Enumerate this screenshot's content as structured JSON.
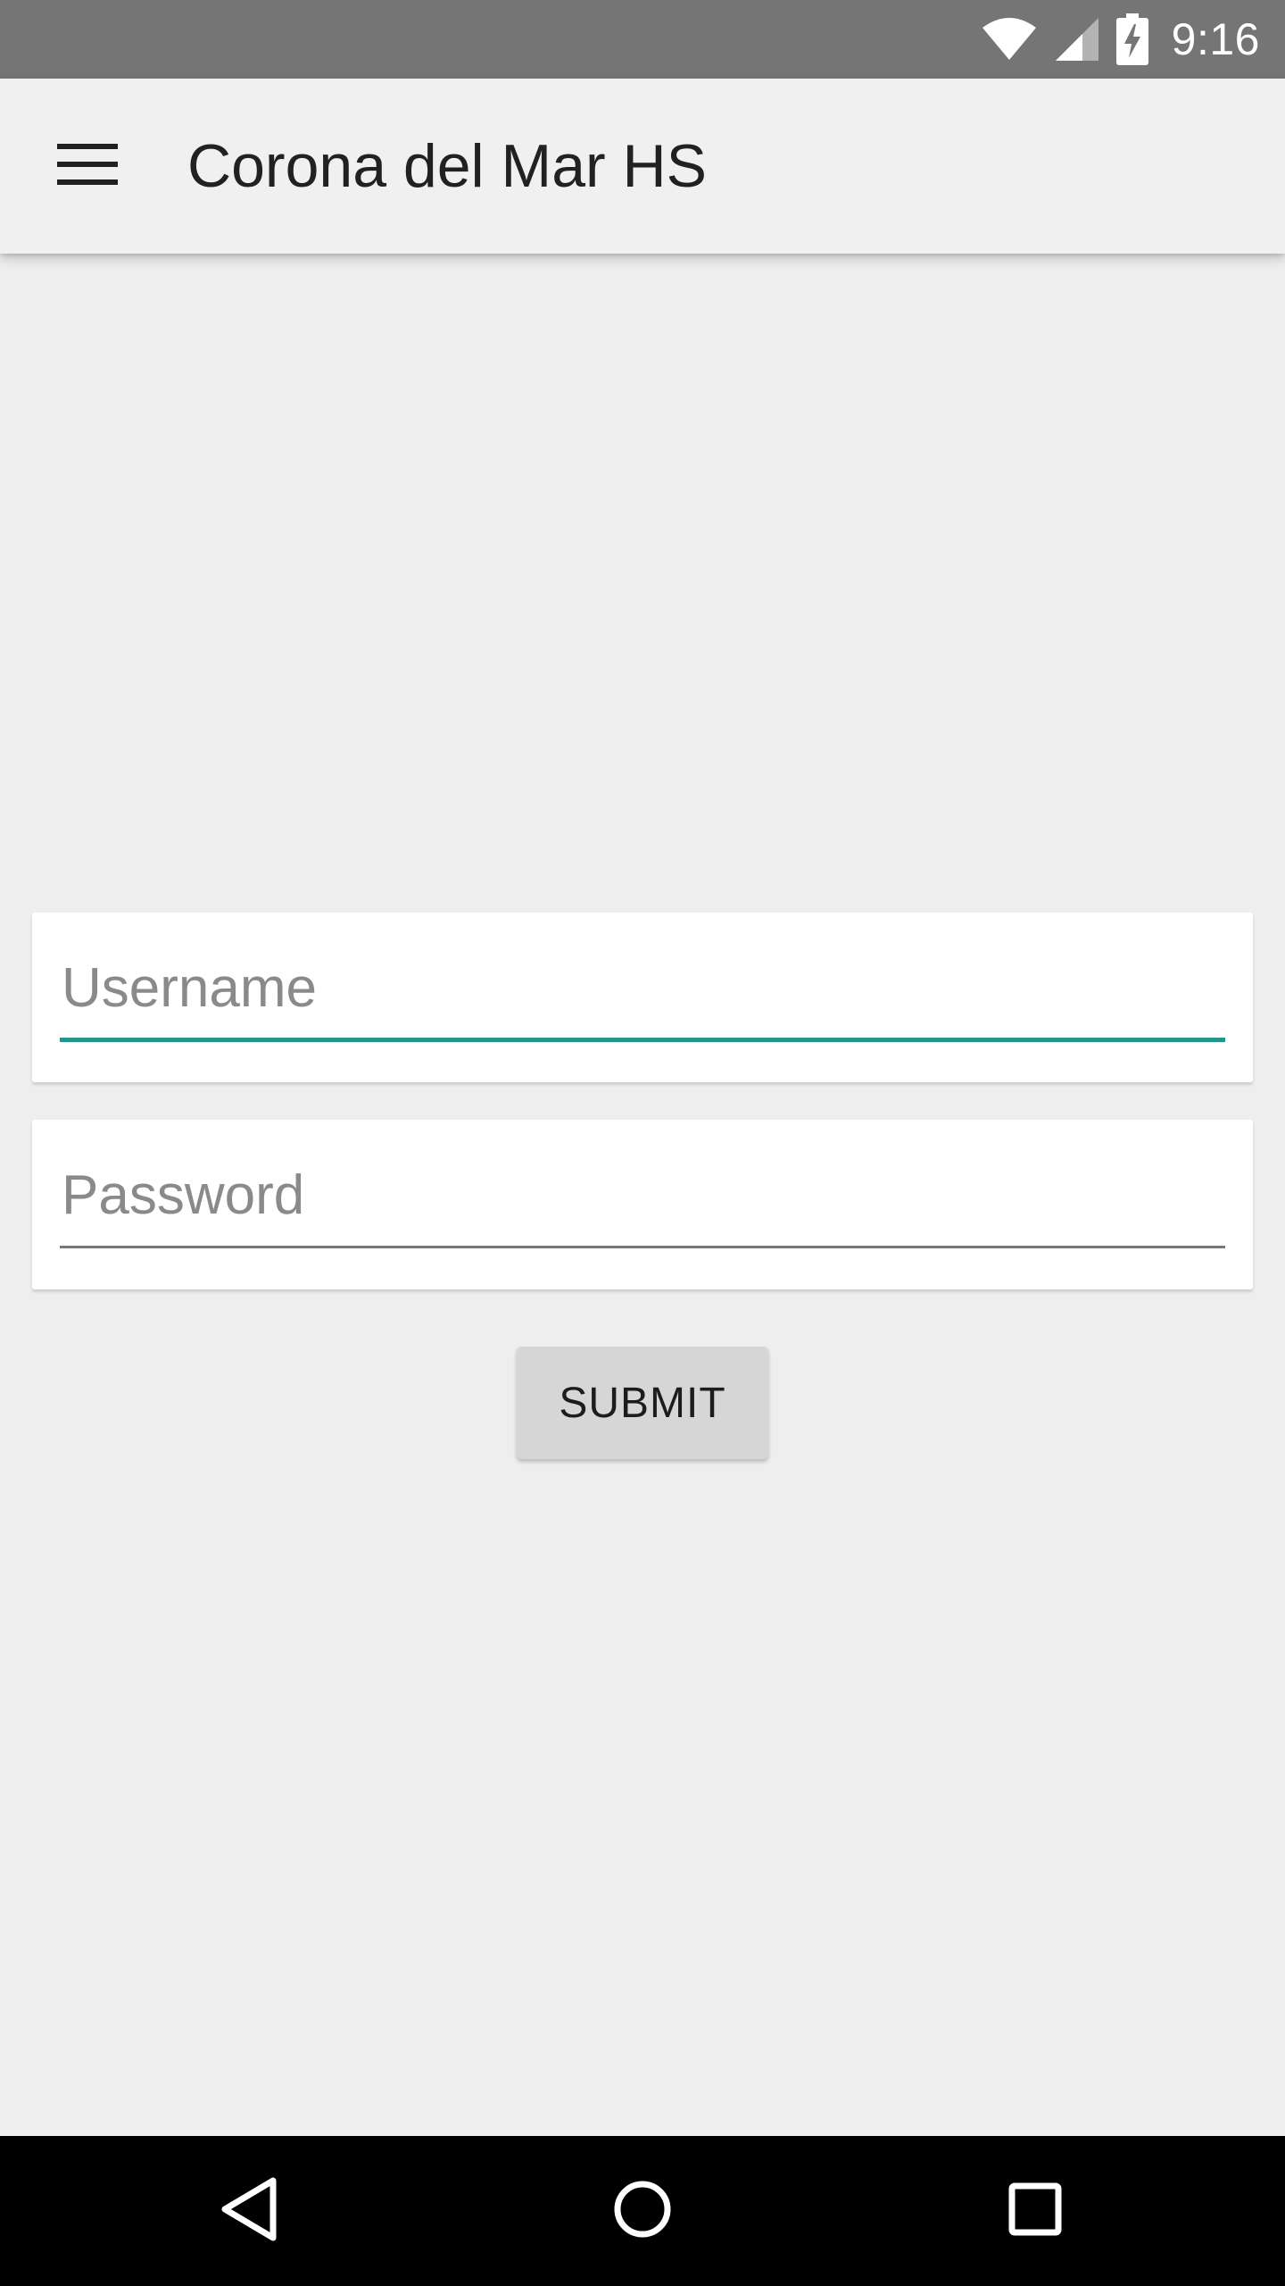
{
  "status_bar": {
    "time": "9:16",
    "icons": [
      "wifi-icon",
      "cell-signal-icon",
      "battery-charging-icon"
    ]
  },
  "app_bar": {
    "title": "Corona del Mar HS",
    "menu_icon": "hamburger-menu-icon"
  },
  "login_form": {
    "username": {
      "placeholder": "Username",
      "value": "",
      "focused": true
    },
    "password": {
      "placeholder": "Password",
      "value": "",
      "focused": false
    },
    "submit_label": "SUBMIT"
  },
  "nav_bar": {
    "buttons": [
      "back-icon",
      "home-icon",
      "recents-icon"
    ]
  },
  "colors": {
    "status_bar": "#757575",
    "app_bar": "#f0f0f0",
    "background": "#eeeeee",
    "focus_accent": "#26968c",
    "button": "#d6d6d6",
    "nav_bar": "#000000"
  }
}
